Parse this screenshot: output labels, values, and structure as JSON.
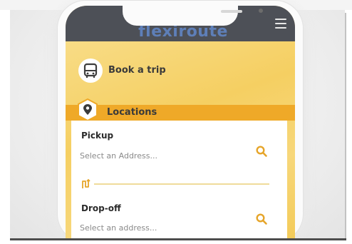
{
  "app": {
    "brand_name": "flexiroute",
    "menu_icon": "hamburger-menu-icon"
  },
  "colors": {
    "header": "#4d5057",
    "accent": "#efa928",
    "accent_icon": "#e6a52a",
    "background": "#f7d67a",
    "card": "#ffffff"
  },
  "book_trip": {
    "label": "Book a trip",
    "icon": "bus-icon"
  },
  "locations": {
    "label": "Locations",
    "icon": "map-pin-icon"
  },
  "pickup": {
    "label": "Pickup",
    "placeholder": "Select an Address...",
    "icon": "search-icon"
  },
  "swap": {
    "icon": "route-swap-icon"
  },
  "dropoff": {
    "label": "Drop-off",
    "placeholder": "Select an address...",
    "icon": "search-icon"
  }
}
